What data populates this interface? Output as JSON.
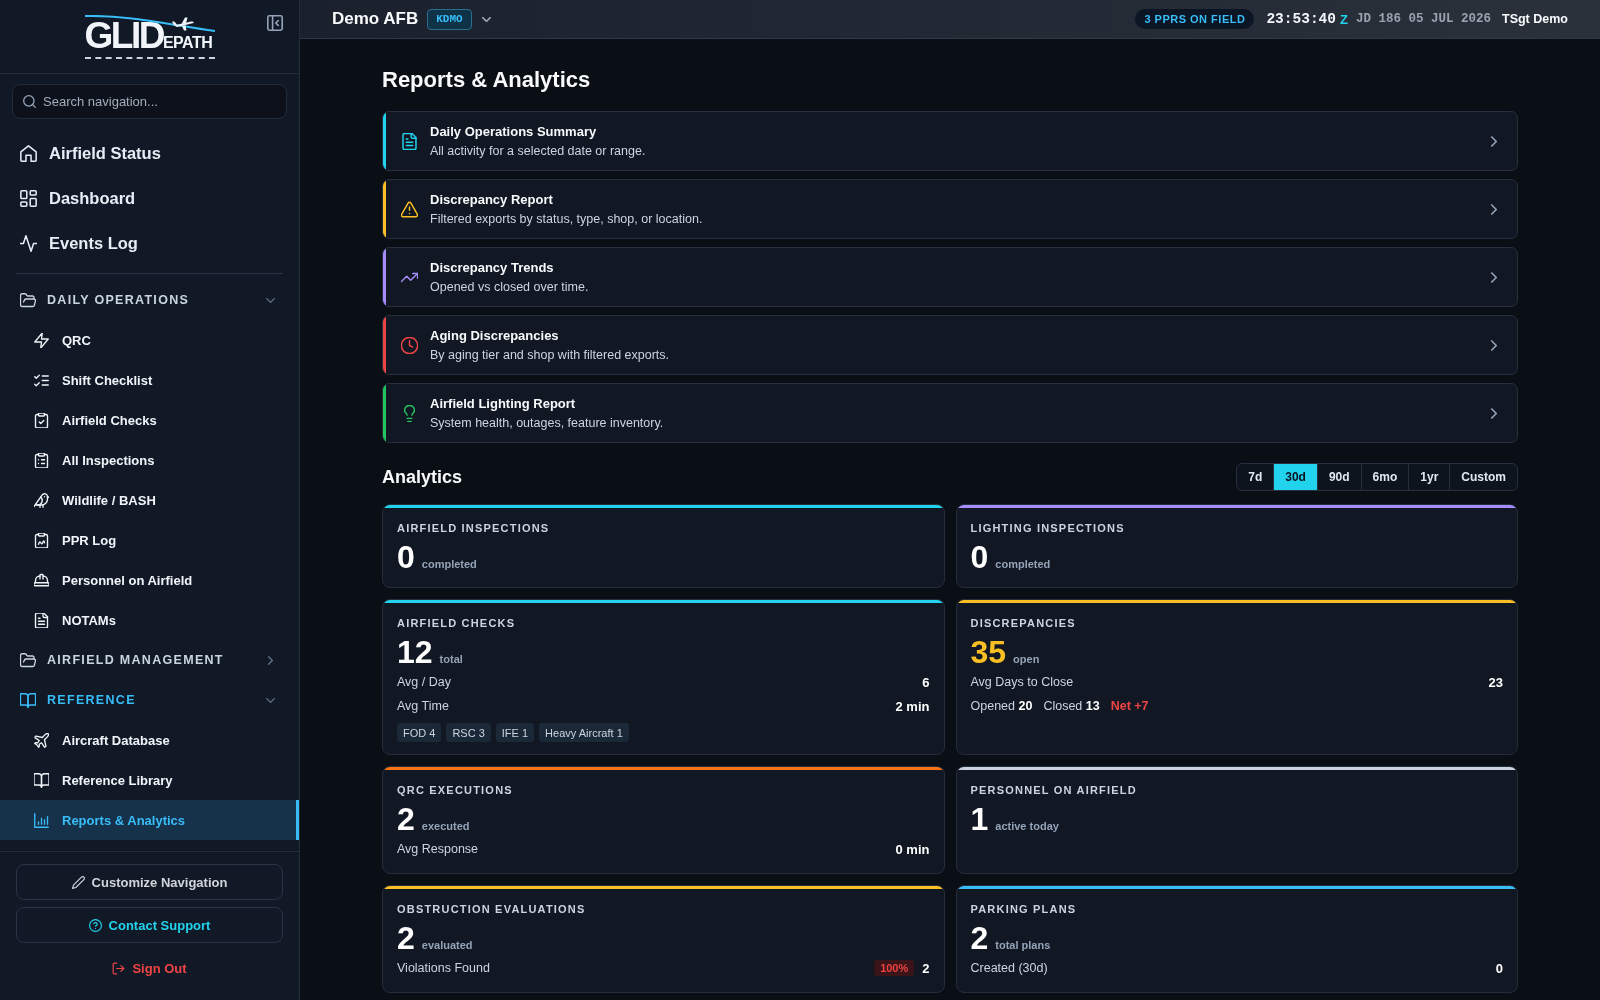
{
  "sidebar": {
    "logo": {
      "lead": "GLID",
      "tail": "EPATH"
    },
    "search": {
      "placeholder": "Search navigation..."
    },
    "top_items": [
      {
        "label": "Airfield Status",
        "selected": false
      },
      {
        "label": "Dashboard",
        "selected": false
      },
      {
        "label": "Events Log",
        "selected": false
      }
    ],
    "groups": [
      {
        "label": "DAILY OPERATIONS",
        "expanded": true,
        "children": [
          {
            "label": "QRC",
            "selected": false
          },
          {
            "label": "Shift Checklist",
            "selected": false
          },
          {
            "label": "Airfield Checks",
            "selected": false
          },
          {
            "label": "All Inspections",
            "selected": false
          },
          {
            "label": "Wildlife / BASH",
            "selected": false
          },
          {
            "label": "PPR Log",
            "selected": false
          },
          {
            "label": "Personnel on Airfield",
            "selected": false
          },
          {
            "label": "NOTAMs",
            "selected": false
          }
        ]
      },
      {
        "label": "AIRFIELD MANAGEMENT",
        "expanded": false
      },
      {
        "label": "REFERENCE",
        "expanded": true,
        "children": [
          {
            "label": "Aircraft Database",
            "selected": false
          },
          {
            "label": "Reference Library",
            "selected": false
          },
          {
            "label": "Reports & Analytics",
            "selected": true
          }
        ]
      }
    ],
    "footer_buttons": [
      {
        "label": "Customize Navigation",
        "kind": "neutral"
      },
      {
        "label": "Contact Support",
        "kind": "support"
      },
      {
        "label": "Sign Out",
        "kind": "danger"
      }
    ]
  },
  "topbar": {
    "base": "Demo AFB",
    "code": "KDMO",
    "ppr_status": "3 PPRS ON FIELD",
    "time": "23:53:40",
    "zone": "Z",
    "date": "JD 186 05 JUL 2026",
    "user": "TSgt Demo"
  },
  "page_title": "Reports & Analytics",
  "reports": [
    {
      "title": "Daily Operations Summary",
      "description": "All activity for a selected date or range.",
      "color": "#22d3ee"
    },
    {
      "title": "Discrepancy Report",
      "description": "Filtered exports by status, type, shop, or location.",
      "color": "#fbbf24"
    },
    {
      "title": "Discrepancy Trends",
      "description": "Opened vs closed over time.",
      "color": "#a78bfa"
    },
    {
      "title": "Aging Discrepancies",
      "description": "By aging tier and shop with filtered exports.",
      "color": "#ef4444"
    },
    {
      "title": "Airfield Lighting Report",
      "description": "System health, outages, feature inventory.",
      "color": "#22c55e"
    }
  ],
  "analytics": {
    "title": "Analytics",
    "ranges": [
      {
        "label": "7d",
        "selected": false
      },
      {
        "label": "30d",
        "selected": true
      },
      {
        "label": "90d",
        "selected": false
      },
      {
        "label": "6mo",
        "selected": false
      },
      {
        "label": "1yr",
        "selected": false
      },
      {
        "label": "Custom",
        "selected": false
      }
    ],
    "cards": [
      {
        "title": "AIRFIELD INSPECTIONS",
        "color": "#22d3ee",
        "value": "0",
        "unit": "completed",
        "value_colored": false
      },
      {
        "title": "LIGHTING INSPECTIONS",
        "color": "#a78bfa",
        "value": "0",
        "unit": "completed",
        "value_colored": false
      },
      {
        "title": "AIRFIELD CHECKS",
        "color": "#22d3ee",
        "value": "12",
        "unit": "total",
        "value_colored": false,
        "rows": [
          {
            "kind": "stat",
            "label": "Avg / Day",
            "value": "6"
          },
          {
            "kind": "stat",
            "label": "Avg Time",
            "value": "2 min"
          },
          {
            "kind": "tags",
            "tags": [
              "FOD 4",
              "RSC 3",
              "IFE 1",
              "Heavy Aircraft 1"
            ]
          }
        ]
      },
      {
        "title": "DISCREPANCIES",
        "color": "#fbbf24",
        "value": "35",
        "unit": "open",
        "value_colored": true,
        "rows": [
          {
            "kind": "stat",
            "label": "Avg Days to Close",
            "value": "23"
          },
          {
            "kind": "tally",
            "parts": [
              "Opened **20**",
              "Closed **13**"
            ],
            "net": "Net +7"
          }
        ]
      },
      {
        "title": "QRC EXECUTIONS",
        "color": "#f97316",
        "value": "2",
        "unit": "executed",
        "value_colored": false,
        "rows": [
          {
            "kind": "stat",
            "label": "Avg Response",
            "value": "0 min"
          }
        ]
      },
      {
        "title": "PERSONNEL ON AIRFIELD",
        "color": "#cbd5e1",
        "value": "1",
        "unit": "active today",
        "value_colored": false
      },
      {
        "title": "OBSTRUCTION EVALUATIONS",
        "color": "#fbbf24",
        "value": "2",
        "unit": "evaluated",
        "value_colored": false,
        "rows": [
          {
            "kind": "stat",
            "label": "Violations Found",
            "badge": "100%",
            "value": "2"
          }
        ]
      },
      {
        "title": "PARKING PLANS",
        "color": "#38bdf8",
        "value": "2",
        "unit": "total plans",
        "value_colored": false,
        "rows": [
          {
            "kind": "stat",
            "label": "Created (30d)",
            "value": "0"
          }
        ]
      }
    ]
  }
}
